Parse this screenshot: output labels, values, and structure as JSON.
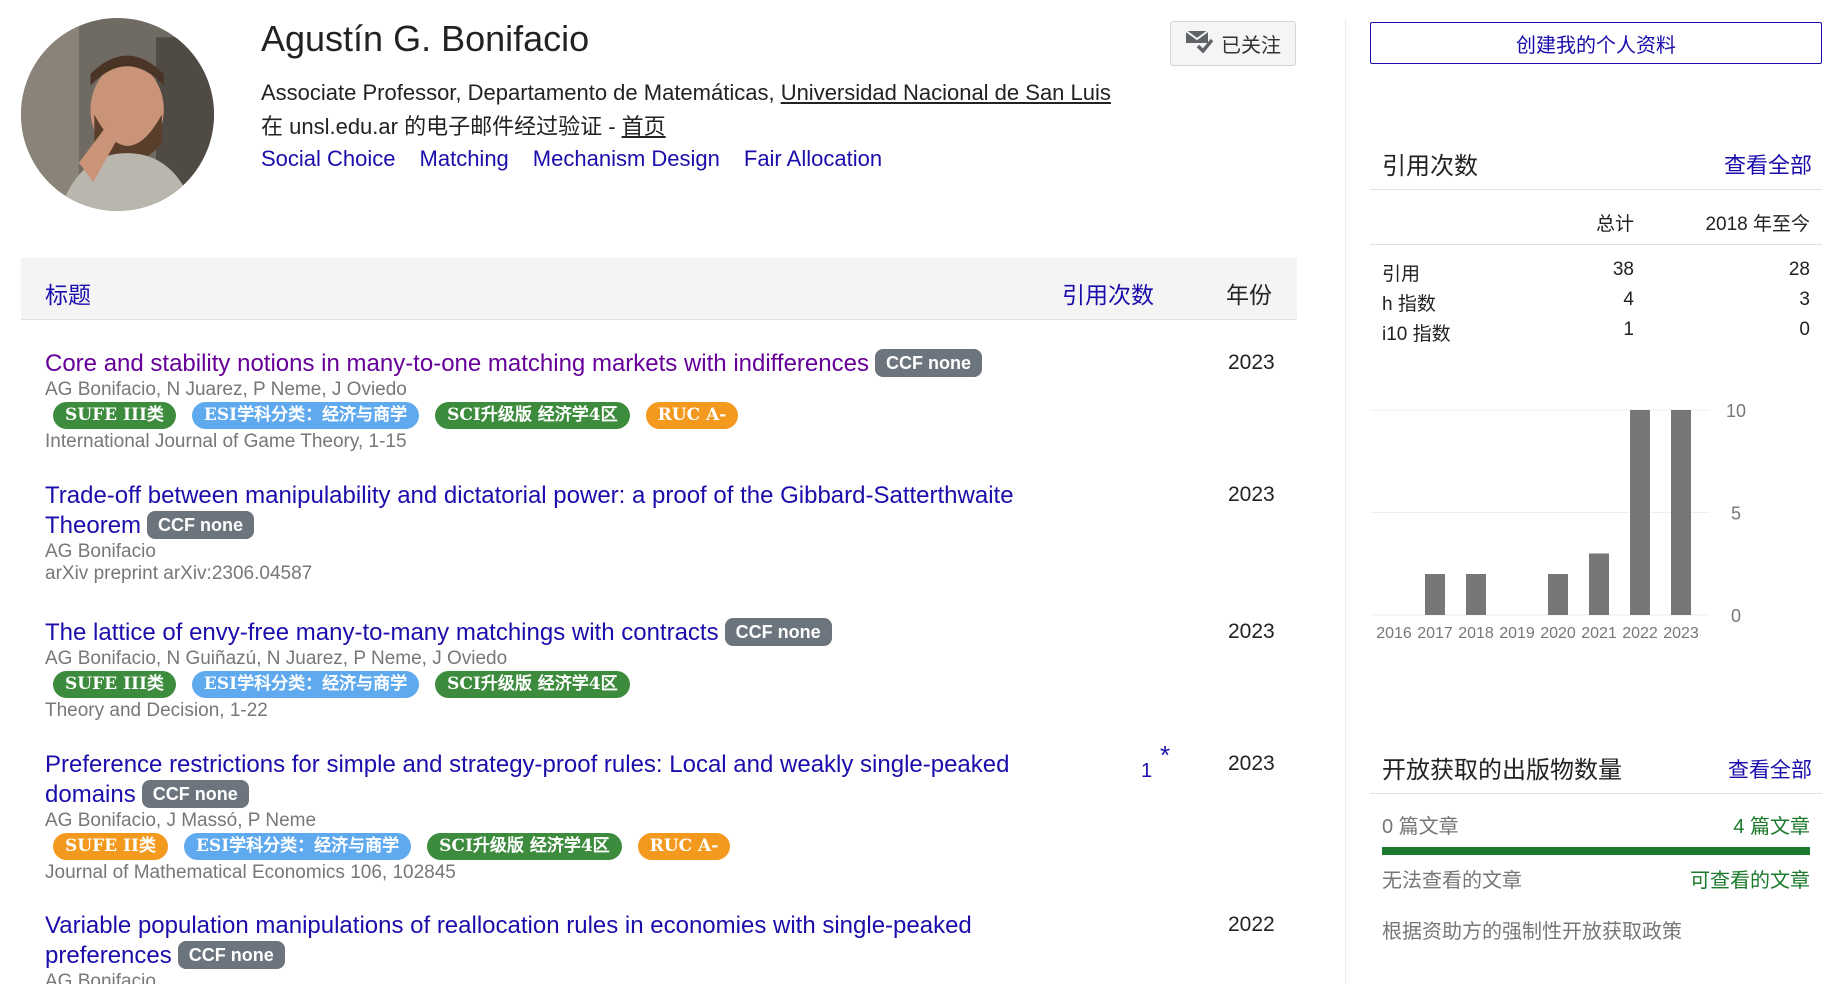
{
  "profile": {
    "name": "Agustín G. Bonifacio",
    "affiliation_prefix": "Associate Professor, Departamento de Matemáticas, ",
    "affiliation_link": "Universidad Nacional de San Luis",
    "verified_prefix": "在 unsl.edu.ar 的电子邮件经过验证 - ",
    "homepage_label": "首页",
    "follow_label": "已关注",
    "interests": [
      "Social Choice",
      "Matching",
      "Mechanism Design",
      "Fair Allocation"
    ]
  },
  "table": {
    "col_title": "标题",
    "col_cited": "引用次数",
    "col_year": "年份"
  },
  "articles": [
    {
      "title": "Core and stability notions in many-to-one matching markets with indifferences",
      "ccf": "CCF none",
      "authors": "AG Bonifacio, N Juarez, P Neme, J Oviedo",
      "badges": [
        {
          "label": "SUFE III类",
          "color": "#3d8b3d"
        },
        {
          "label": "ESI学科分类：经济与商学",
          "color": "#5fa9ee"
        },
        {
          "label": "SCI升级版 经济学4区",
          "color": "#3d8b3d"
        },
        {
          "label": "RUC A-",
          "color": "#f39a1e"
        }
      ],
      "venue": "International Journal of Game Theory, 1-15",
      "cited": "",
      "year": "2023"
    },
    {
      "title": "Trade-off between manipulability and dictatorial power: a proof of the Gibbard-Satterthwaite Theorem",
      "ccf": "CCF none",
      "authors": "AG Bonifacio",
      "badges": [],
      "venue": "arXiv preprint arXiv:2306.04587",
      "cited": "",
      "year": "2023"
    },
    {
      "title": "The lattice of envy-free many-to-many matchings with contracts",
      "ccf": "CCF none",
      "authors": "AG Bonifacio, N Guiñazú, N Juarez, P Neme, J Oviedo",
      "badges": [
        {
          "label": "SUFE III类",
          "color": "#3d8b3d"
        },
        {
          "label": "ESI学科分类：经济与商学",
          "color": "#5fa9ee"
        },
        {
          "label": "SCI升级版 经济学4区",
          "color": "#3d8b3d"
        }
      ],
      "venue": "Theory and Decision, 1-22",
      "cited": "",
      "year": "2023"
    },
    {
      "title": "Preference restrictions for simple and strategy-proof rules: Local and weakly single-peaked domains",
      "ccf": "CCF none",
      "authors": "AG Bonifacio, J Massó, P Neme",
      "badges": [
        {
          "label": "SUFE II类",
          "color": "#f39a1e"
        },
        {
          "label": "ESI学科分类：经济与商学",
          "color": "#5fa9ee"
        },
        {
          "label": "SCI升级版 经济学4区",
          "color": "#3d8b3d"
        },
        {
          "label": "RUC A-",
          "color": "#f39a1e"
        }
      ],
      "venue": "Journal of Mathematical Economics 106, 102845",
      "cited": "1",
      "star": "*",
      "year": "2023"
    },
    {
      "title": "Variable population manipulations of reallocation rules in economies with single-peaked preferences",
      "ccf": "CCF none",
      "authors": "AG Bonifacio",
      "badges": [],
      "venue": "",
      "cited": "",
      "year": "2022"
    }
  ],
  "sidebar": {
    "create_profile_label": "创建我的个人资料",
    "citations": {
      "title": "引用次数",
      "view_all": "查看全部",
      "col_all": "总计",
      "col_since": "2018 年至今",
      "rows": [
        {
          "label": "引用",
          "all": "38",
          "since": "28"
        },
        {
          "label": "h 指数",
          "all": "4",
          "since": "3"
        },
        {
          "label": "i10 指数",
          "all": "1",
          "since": "0"
        }
      ]
    },
    "open_access": {
      "title": "开放获取的出版物数量",
      "view_all": "查看全部",
      "not_available_count": "0 篇文章",
      "available_count": "4 篇文章",
      "not_available_label": "无法查看的文章",
      "available_label": "可查看的文章",
      "available_fraction": 1.0,
      "note": "根据资助方的强制性开放获取政策",
      "accent": "#1b7a2b"
    }
  },
  "chart_data": {
    "type": "bar",
    "categories": [
      "2016",
      "2017",
      "2018",
      "2019",
      "2020",
      "2021",
      "2022",
      "2023"
    ],
    "values": [
      0,
      2,
      2,
      0,
      2,
      3,
      10,
      10
    ],
    "yticks": [
      "10",
      "5",
      "0"
    ],
    "ylim": [
      0,
      10
    ],
    "bar_color": "#777777",
    "grid": true
  },
  "colors": {
    "link": "#1a0dab",
    "visited": "#660099",
    "ccf_badge": "#6c757d"
  }
}
